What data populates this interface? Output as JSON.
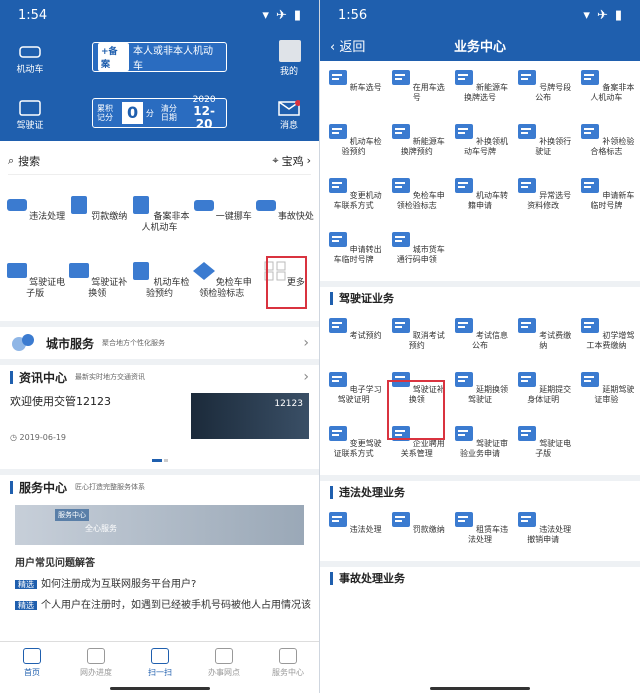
{
  "left": {
    "status": {
      "time": "1:54"
    },
    "header": {
      "vehicle_label": "机动车",
      "me_label": "我的",
      "license_label": "驾驶证",
      "msg_label": "消息",
      "plate_tag": "+备案",
      "plate_text": "本人或非本人机动车",
      "score_label": "累积记分",
      "score_value": "0",
      "score_unit": "分",
      "clear_label": "清分日期",
      "clear_year": "2020",
      "clear_date": "12-20"
    },
    "search": {
      "placeholder": "搜索",
      "city": "宝鸡"
    },
    "grid": [
      {
        "label": "违法处理"
      },
      {
        "label": "罚款缴纳"
      },
      {
        "label": "备案非本人机动车"
      },
      {
        "label": "一键挪车"
      },
      {
        "label": "事故快处"
      },
      {
        "label": "驾驶证电子版"
      },
      {
        "label": "驾驶证补换领"
      },
      {
        "label": "机动车检验预约"
      },
      {
        "label": "免检车申领检验标志"
      },
      {
        "label": "更多"
      }
    ],
    "city_service": {
      "title": "城市服务",
      "sub": "聚合地方个性化服务"
    },
    "news": {
      "title": "资讯中心",
      "sub": "最新实时地方交通资讯",
      "headline": "欢迎使用交管12123",
      "date": "2019-06-19",
      "pic_text": "12123"
    },
    "service": {
      "title": "服务中心",
      "sub": "匠心打造完整服务体系",
      "banner_tag": "服务中心",
      "banner_text": "全心服务",
      "faq_title": "用户常见问题解答",
      "faq1_tag": "精选",
      "faq1": "如何注册成为互联网服务平台用户?",
      "faq2_tag": "精选",
      "faq2": "个人用户在注册时，如遇到已经被手机号码被他人占用情况该"
    },
    "tabs": [
      {
        "label": "首页"
      },
      {
        "label": "网办进度"
      },
      {
        "label": "扫一扫"
      },
      {
        "label": "办事网点"
      },
      {
        "label": "服务中心"
      }
    ]
  },
  "right": {
    "status": {
      "time": "1:56"
    },
    "back": "返回",
    "title": "业务中心",
    "veh_items": [
      {
        "label": "新车选号"
      },
      {
        "label": "在用车选号"
      },
      {
        "label": "新能源车换牌选号"
      },
      {
        "label": "号牌号段公布"
      },
      {
        "label": "备案非本人机动车"
      },
      {
        "label": "机动车检验预约"
      },
      {
        "label": "新能源车换牌预约"
      },
      {
        "label": "补换领机动车号牌"
      },
      {
        "label": "补换领行驶证"
      },
      {
        "label": "补领检验合格标志"
      },
      {
        "label": "变更机动车联系方式"
      },
      {
        "label": "免检车申领检验标志"
      },
      {
        "label": "机动车转籍申请"
      },
      {
        "label": "异常选号资料修改"
      },
      {
        "label": "申请新车临时号牌"
      },
      {
        "label": "申请转出车临时号牌"
      },
      {
        "label": "城市货车通行码申领"
      }
    ],
    "license_section": "驾驶证业务",
    "lic_items": [
      {
        "label": "考试预约"
      },
      {
        "label": "取消考试预约"
      },
      {
        "label": "考试信息公布"
      },
      {
        "label": "考试费缴纳"
      },
      {
        "label": "初学增驾工本费缴纳"
      },
      {
        "label": "电子学习驾驶证明"
      },
      {
        "label": "驾驶证补换领"
      },
      {
        "label": "延期换领驾驶证"
      },
      {
        "label": "延期提交身体证明"
      },
      {
        "label": "延期驾驶证审验"
      },
      {
        "label": "变更驾驶证联系方式"
      },
      {
        "label": "企业聘用关系管理"
      },
      {
        "label": "驾驶证审验业务申请"
      },
      {
        "label": "驾驶证电子版"
      }
    ],
    "violation_section": "违法处理业务",
    "vio_items": [
      {
        "label": "违法处理"
      },
      {
        "label": "罚款缴纳"
      },
      {
        "label": "租赁车违法处理"
      },
      {
        "label": "违法处理撤销申请"
      }
    ],
    "accident_section": "事故处理业务"
  },
  "colors": {
    "brand": "#1f5fae",
    "highlight": "#d9333f"
  }
}
